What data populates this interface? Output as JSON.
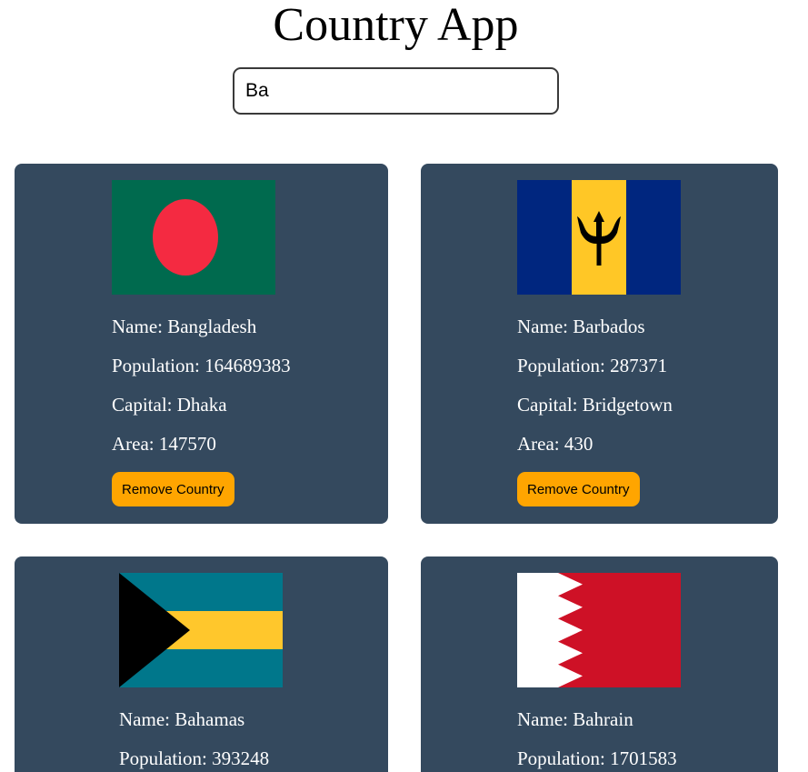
{
  "app": {
    "title": "Country App"
  },
  "search": {
    "value": "Ba"
  },
  "labels": {
    "name": "Name:",
    "population": "Population:",
    "capital": "Capital:",
    "area": "Area:",
    "remove_button": "Remove Country"
  },
  "countries": [
    {
      "name": "Bangladesh",
      "population": "164689383",
      "capital": "Dhaka",
      "area": "147570",
      "flag": "bangladesh-flag-icon"
    },
    {
      "name": "Barbados",
      "population": "287371",
      "capital": "Bridgetown",
      "area": "430",
      "flag": "barbados-flag-icon"
    },
    {
      "name": "Bahamas",
      "population": "393248",
      "flag": "bahamas-flag-icon"
    },
    {
      "name": "Bahrain",
      "population": "1701583",
      "flag": "bahrain-flag-icon"
    }
  ],
  "colors": {
    "page_background": "#ffffff",
    "card_background": "#34495e",
    "card_text": "#ffffff",
    "button_background": "#ffa500",
    "button_text": "#000000"
  }
}
